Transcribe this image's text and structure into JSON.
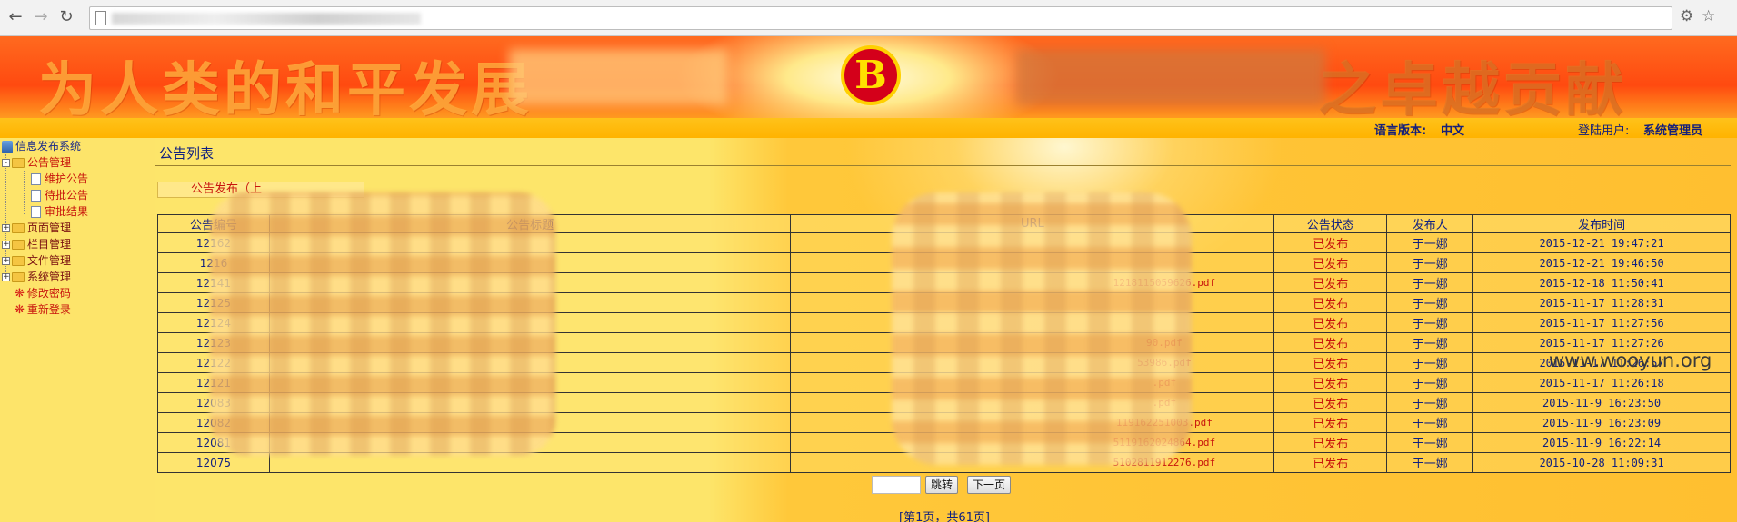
{
  "browser": {
    "back_icon": "arrow-left-icon",
    "forward_icon": "arrow-right-icon",
    "reload_icon": "reload-icon"
  },
  "banner": {
    "slogan_left": "为人类的和平发展",
    "slogan_right": "之卓越贡献",
    "logo_text": "B"
  },
  "status": {
    "language_label": "语言版本:",
    "language_value": "中文",
    "user_label": "登陆用户:",
    "user_value": "系统管理员"
  },
  "sidebar": {
    "root": "信息发布系统",
    "notice_mgmt": "公告管理",
    "notice_children": [
      "维护公告",
      "待批公告",
      "审批结果"
    ],
    "page_mgmt": "页面管理",
    "column_mgmt": "栏目管理",
    "file_mgmt": "文件管理",
    "system_mgmt": "系统管理",
    "change_password": "修改密码",
    "relogin": "重新登录"
  },
  "main": {
    "panel_title": "公告列表",
    "subtab_label": "公告发布（上",
    "columns": [
      "公告编号",
      "公告标题",
      "URL",
      "公告状态",
      "发布人",
      "发布时间"
    ],
    "rows": [
      {
        "id": "12162",
        "title": "",
        "url": "",
        "status": "已发布",
        "publisher": "于一娜",
        "time": "2015-12-21 19:47:21"
      },
      {
        "id": "1216",
        "title": "",
        "url": "",
        "status": "已发布",
        "publisher": "于一娜",
        "time": "2015-12-21 19:46:50"
      },
      {
        "id": "12141",
        "title": "",
        "url": "1218115059626.pdf",
        "status": "已发布",
        "publisher": "于一娜",
        "time": "2015-12-18 11:50:41"
      },
      {
        "id": "12125",
        "title": "",
        "url": "",
        "status": "已发布",
        "publisher": "于一娜",
        "time": "2015-11-17 11:28:31"
      },
      {
        "id": "12124",
        "title": "",
        "url": "",
        "status": "已发布",
        "publisher": "于一娜",
        "time": "2015-11-17 11:27:56"
      },
      {
        "id": "12123",
        "title": "",
        "url": "90.pdf",
        "status": "已发布",
        "publisher": "于一娜",
        "time": "2015-11-17 11:27:26"
      },
      {
        "id": "12122",
        "title": "",
        "url": "53986.pdf",
        "status": "已发布",
        "publisher": "于一娜",
        "time": "2015-11-17 11:26:57"
      },
      {
        "id": "12121",
        "title": "",
        "url": ".pdf",
        "status": "已发布",
        "publisher": "于一娜",
        "time": "2015-11-17 11:26:18"
      },
      {
        "id": "12083",
        "title": "",
        "url": ".pdf",
        "status": "已发布",
        "publisher": "于一娜",
        "time": "2015-11-9 16:23:50"
      },
      {
        "id": "12082",
        "title": "",
        "url": "119162251003.pdf",
        "status": "已发布",
        "publisher": "于一娜",
        "time": "2015-11-9 16:23:09"
      },
      {
        "id": "12081",
        "title": "",
        "url": "5119162024864.pdf",
        "status": "已发布",
        "publisher": "于一娜",
        "time": "2015-11-9 16:22:14"
      },
      {
        "id": "12075",
        "title": "",
        "url": "5102811912276.pdf",
        "status": "已发布",
        "publisher": "于一娜",
        "time": "2015-10-28 11:09:31"
      }
    ],
    "jump_button": "跳转",
    "next_button": "下一页",
    "page_info": "[第1页，共61页]"
  },
  "watermark": "www.wooyun.org"
}
